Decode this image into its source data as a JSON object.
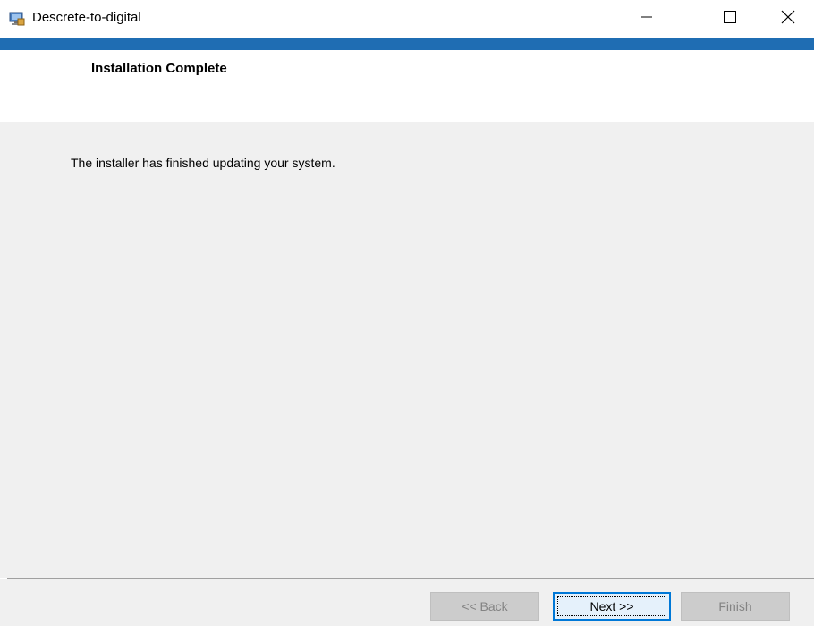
{
  "window": {
    "title": "Descrete-to-digital",
    "accent_color": "#1f6db3",
    "controls": {
      "minimize_icon": "minimize-icon",
      "maximize_icon": "maximize-icon",
      "close_icon": "close-icon"
    }
  },
  "header": {
    "title": "Installation Complete"
  },
  "body": {
    "message": "The installer has finished updating your system."
  },
  "footer": {
    "back_label": "<< Back",
    "next_label": "Next >>",
    "finish_label": "Finish",
    "back_enabled": false,
    "next_enabled": true,
    "finish_enabled": false
  }
}
